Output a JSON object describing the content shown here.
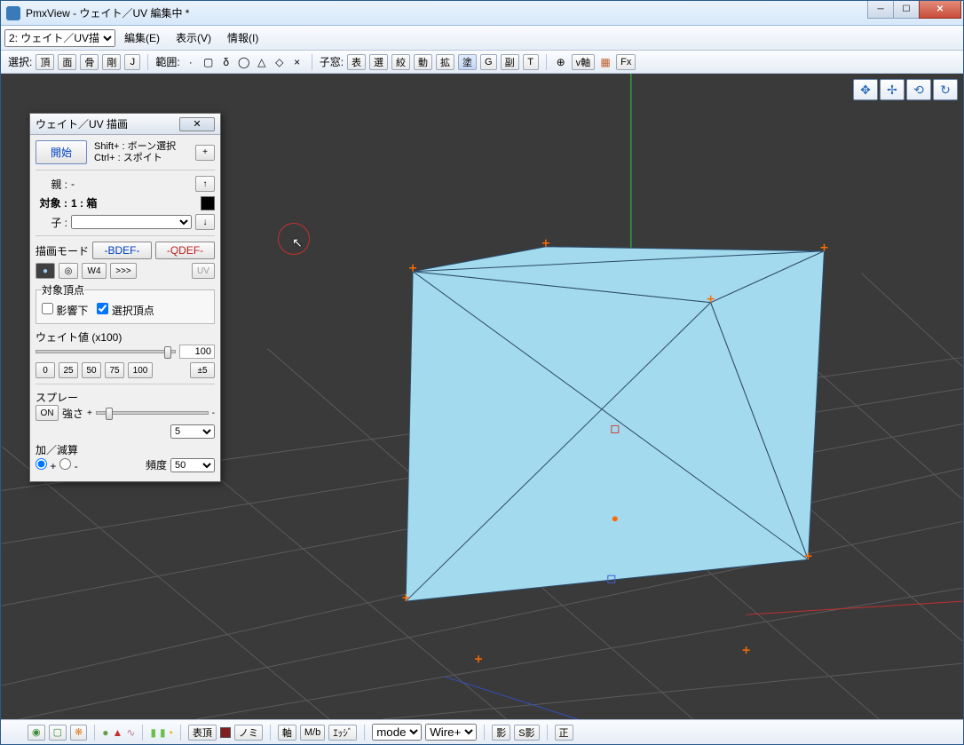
{
  "window": {
    "title": "PmxView  - ウェイト／UV 編集中 *"
  },
  "menubar": {
    "mode_selector": "2: ウェイト／UV描",
    "edit": "編集(E)",
    "view": "表示(V)",
    "info": "情報(I)"
  },
  "toolbar": {
    "select_label": "選択:",
    "vertex": "頂",
    "face": "面",
    "bone": "骨",
    "rigid": "剛",
    "joint": "J",
    "range_label": "範囲:",
    "subwindow_label": "子窓:",
    "sw_table": "表",
    "sw_select": "選",
    "sw_narrow": "絞",
    "sw_move": "動",
    "sw_expand": "拡",
    "sw_paint": "塗",
    "sw_g": "G",
    "sw_sub": "副",
    "sw_t": "T",
    "vaxis": "v軸",
    "fx": "Fx"
  },
  "panel": {
    "title": "ウェイト／UV 描画",
    "start": "開始",
    "hint1": "Shift+ : ボーン選択",
    "hint2": "Ctrl+ : スポイト",
    "plus": "+",
    "parent_label": "親 :",
    "parent_value": "-",
    "up_arrow": "↑",
    "target_label": "対象 :",
    "target_value": "1 : 箱",
    "child_label": "子 :",
    "down_arrow": "↓",
    "paint_mode_label": "描画モード",
    "bdef": "-BDEF-",
    "qdef": "-QDEF-",
    "w4": "W4",
    "more": ">>>",
    "uv": "UV",
    "target_vertex_legend": "対象頂点",
    "influence_cb": "影響下",
    "selected_cb": "選択頂点",
    "weight_label": "ウェイト値 (x100)",
    "weight_value": "100",
    "w0": "0",
    "w25": "25",
    "w50": "50",
    "w75": "75",
    "w100": "100",
    "pm5": "±5",
    "spray_label": "スプレー",
    "spray_on": "ON",
    "strength_label": "強さ",
    "strength_value": "5",
    "addsub_label": "加／減算",
    "plus_sign": "+",
    "minus_sign": "-",
    "freq_label": "頻度",
    "freq_value": "50"
  },
  "bottombar": {
    "vertex": "表頂",
    "nomi": "ノミ",
    "axis": "軸",
    "mb": "M/b",
    "edge": "ｴｯｼﾞ",
    "mode": "mode",
    "wire": "Wire+",
    "shadow": "影",
    "sshadow": "S影",
    "ortho": "正"
  },
  "gizmo": {
    "move": "✥",
    "pan": "✢",
    "rotate": "⟲",
    "zoom": "↻"
  }
}
